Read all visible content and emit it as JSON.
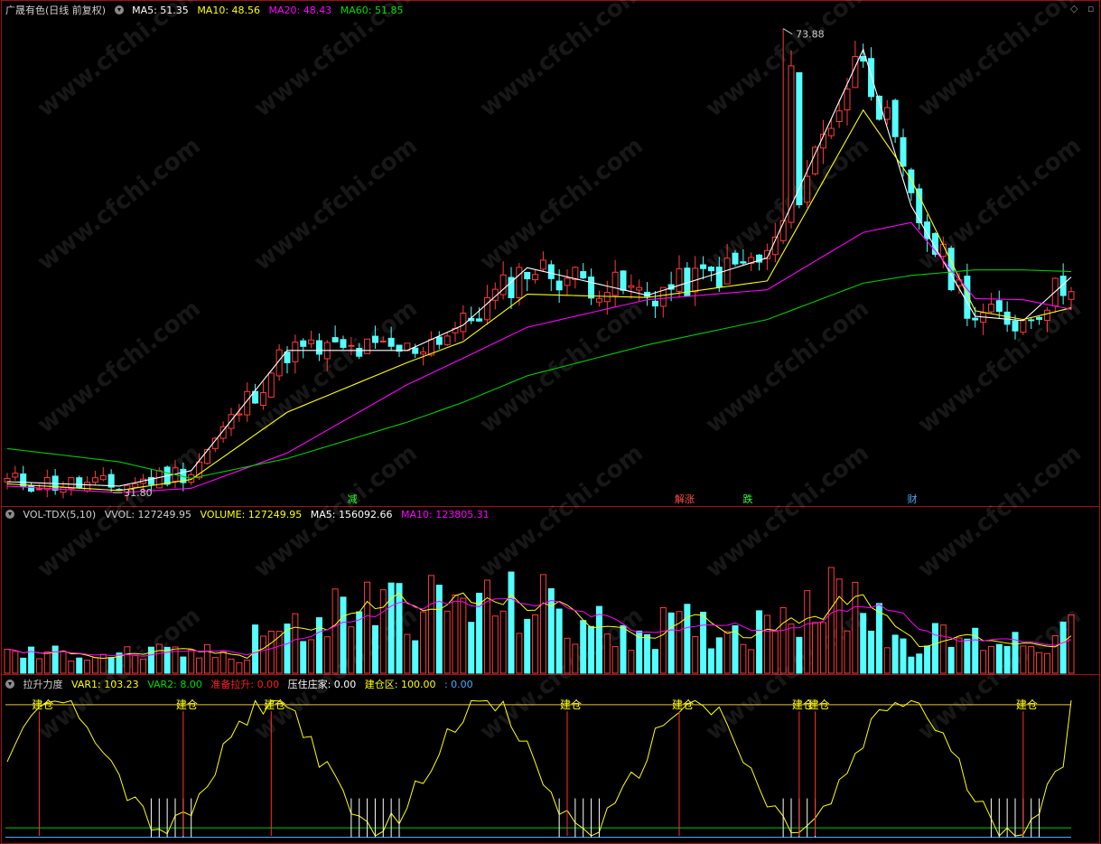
{
  "main": {
    "title": "广晟有色(日线 前复权)",
    "ma5": "MA5: 51.35",
    "ma10": "MA10: 48.56",
    "ma20": "MA20: 48.43",
    "ma60": "MA60: 51.85",
    "high_label": "73.88",
    "low_label": "31.80",
    "events": [
      "减",
      "解涨",
      "跌",
      "财"
    ]
  },
  "volume": {
    "title": "VOL-TDX(5,10)",
    "vvol": "VVOL: 127249.95",
    "volume": "VOLUME: 127249.95",
    "ma5": "MA5: 156092.66",
    "ma10": "MA10: 123805.31"
  },
  "indicator": {
    "title": "拉升力度",
    "var1": "VAR1: 103.23",
    "var2": "VAR2: 8.00",
    "ready": "准备拉升: 0.00",
    "press": "压住庄家: 0.00",
    "build": "建仓区: 100.00",
    "extra": ": 0.00",
    "signal_label": "建仓",
    "signal_count": 8
  },
  "watermark": "www.cfchi.com",
  "colors": {
    "up": "#ff3b3b",
    "down": "#54ffff",
    "ma5": "#ffffff",
    "ma10": "#ffff00",
    "ma20": "#ff00ff",
    "ma60": "#00cc00",
    "frame": "#a01010"
  },
  "chart_data": [
    {
      "type": "line",
      "title": "广晟有色(日线 前复权)",
      "description_series": [
        "MA5",
        "MA10",
        "MA20",
        "MA60"
      ],
      "x": [
        0,
        14,
        23,
        35,
        50,
        57,
        65,
        80,
        95,
        107,
        113,
        121,
        127,
        133
      ],
      "series": [
        {
          "name": "MA5",
          "values": [
            32.8,
            32.4,
            33.8,
            44.7,
            44.7,
            47.0,
            52.2,
            49.7,
            53.1,
            72.0,
            57.8,
            47.8,
            47.4,
            51.35
          ]
        },
        {
          "name": "MA10",
          "values": [
            32.6,
            32.0,
            33.0,
            39.1,
            43.6,
            45.5,
            49.8,
            49.5,
            51.0,
            66.5,
            60.2,
            48.3,
            47.5,
            48.56
          ]
        },
        {
          "name": "MA20",
          "values": [
            32.4,
            31.8,
            32.2,
            35.4,
            41.6,
            44.0,
            46.8,
            49.3,
            50.2,
            55.4,
            56.3,
            49.4,
            49.3,
            48.43
          ]
        },
        {
          "name": "MA60",
          "values": [
            35.8,
            34.6,
            33.1,
            34.9,
            38.2,
            40.0,
            42.4,
            45.2,
            47.5,
            50.8,
            51.5,
            52.0,
            52.0,
            51.85
          ]
        }
      ],
      "extremes": {
        "high": 73.88,
        "low": 31.8
      },
      "ylim": [
        31.0,
        75.0
      ]
    },
    {
      "type": "bar",
      "title": "VOL-TDX(5,10)",
      "series": [
        {
          "name": "VOLUME",
          "last": 127249.95
        },
        {
          "name": "MA5",
          "last": 156092.66
        },
        {
          "name": "MA10",
          "last": 123805.31
        }
      ]
    },
    {
      "type": "line",
      "title": "拉升力度",
      "series": [
        {
          "name": "VAR1",
          "last": 103.23
        },
        {
          "name": "VAR2",
          "last": 8.0
        }
      ],
      "ylim": [
        0,
        110
      ]
    }
  ]
}
